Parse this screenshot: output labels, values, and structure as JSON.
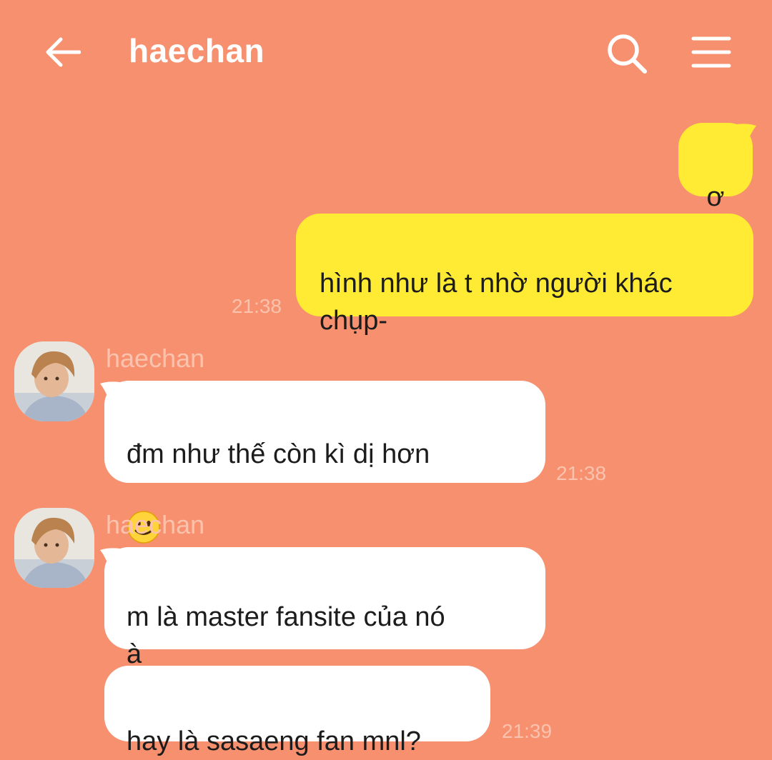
{
  "header": {
    "title": "haechan",
    "back_icon": "arrow-left-icon",
    "search_icon": "search-icon",
    "menu_icon": "hamburger-menu-icon"
  },
  "colors": {
    "background": "#f6906e",
    "my_bubble": "#ffeb33",
    "their_bubble": "#ffffff",
    "meta_text": "#fbc3ae"
  },
  "messages": [
    {
      "sender": "me",
      "text": "ơ"
    },
    {
      "sender": "me",
      "text": "hình như là t nhờ người khác\nchụp-",
      "time": "21:38"
    },
    {
      "sender": "haechan",
      "name": "haechan",
      "text": "đm như thế còn kì dị hơn",
      "emoji": "slightly-smiling-face",
      "time": "21:38"
    },
    {
      "sender": "haechan",
      "name": "haechan",
      "text": "m là master fansite của nó\nà",
      "emoji": "slightly-smiling-face"
    },
    {
      "sender": "haechan",
      "text": "hay là sasaeng fan mnl?",
      "time": "21:39"
    }
  ]
}
